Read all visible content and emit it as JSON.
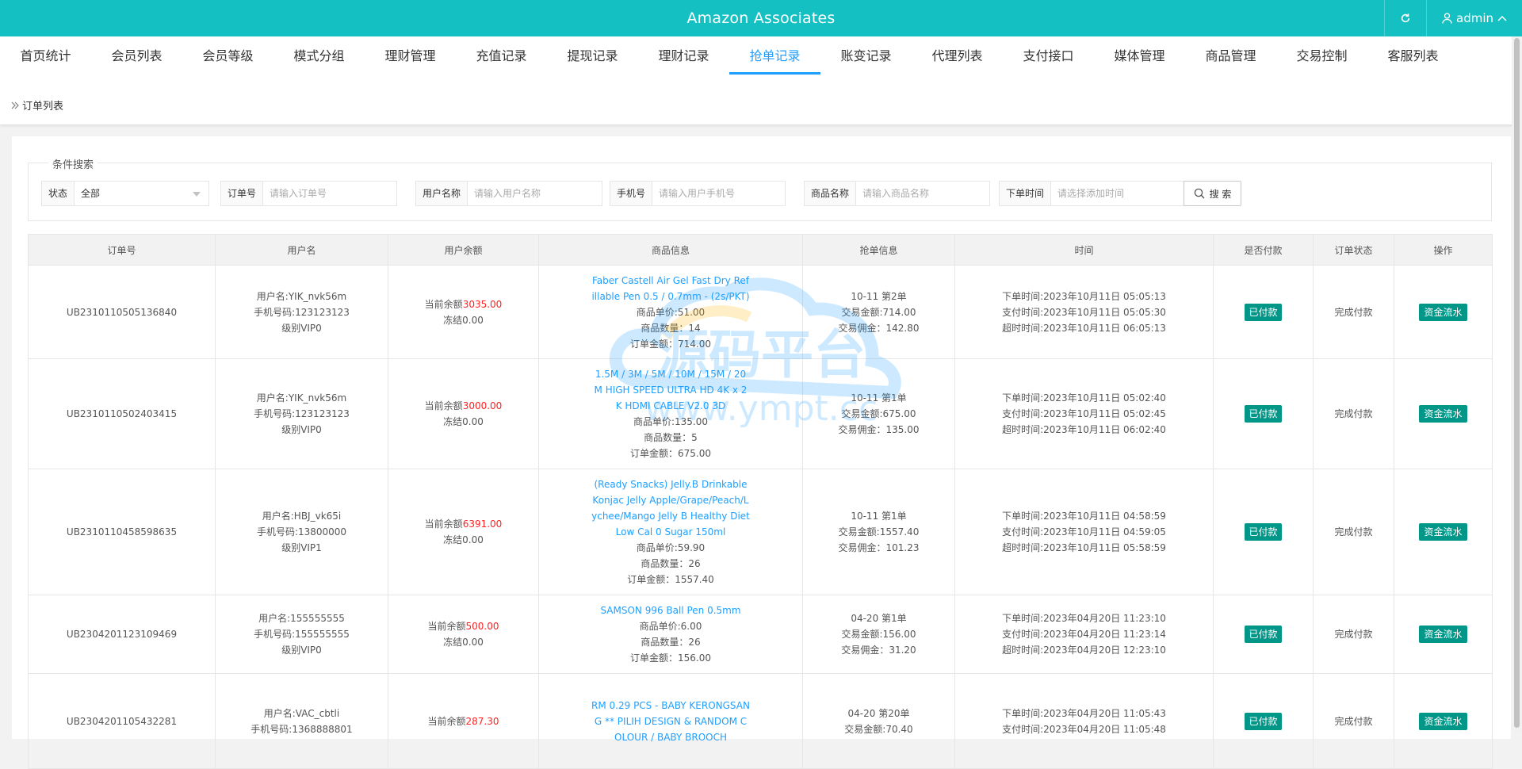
{
  "app": {
    "title": "Amazon Associates",
    "user": "admin"
  },
  "nav": {
    "tabs": [
      "首页统计",
      "会员列表",
      "会员等级",
      "模式分组",
      "理财管理",
      "充值记录",
      "提现记录",
      "理财记录",
      "抢单记录",
      "账变记录",
      "代理列表",
      "支付接口",
      "媒体管理",
      "商品管理",
      "交易控制",
      "客服列表"
    ],
    "active": "抢单记录"
  },
  "breadcrumb": "订单列表",
  "search": {
    "legend": "条件搜索",
    "status_label": "状态",
    "status_value": "全部",
    "order_label": "订单号",
    "order_placeholder": "请输入订单号",
    "username_label": "用户名称",
    "username_placeholder": "请输入用户名称",
    "phone_label": "手机号",
    "phone_placeholder": "请输入用户手机号",
    "goods_label": "商品名称",
    "goods_placeholder": "请输入商品名称",
    "time_label": "下单时间",
    "time_placeholder": "请选择添加时间",
    "button": "搜 索"
  },
  "table": {
    "headers": [
      "订单号",
      "用户名",
      "用户余额",
      "商品信息",
      "抢单信息",
      "时间",
      "是否付款",
      "订单状态",
      "操作"
    ],
    "rows": [
      {
        "order_no": "UB2310110505136840",
        "user": [
          "用户名:YIK_nvk56m",
          "手机号码:123123123",
          "级别VIP0"
        ],
        "balance_prefix": "当前余额",
        "balance": "3035.00",
        "frozen": "冻结0.00",
        "goods_name": "Faber Castell Air Gel Fast Dry Refillable Pen 0.5 / 0.7mm - (2s/PKT)",
        "goods_lines": [
          "商品单价:51.00",
          "商品数量：14",
          "订单金额：714.00"
        ],
        "grab": [
          "10-11 第2单",
          "交易金额:714.00",
          "交易佣金：142.80"
        ],
        "times": [
          "下单时间:2023年10月11日 05:05:13",
          "支付时间:2023年10月11日 05:05:30",
          "超时时间:2023年10月11日 06:05:13"
        ],
        "paid": "已付款",
        "status": "完成付款",
        "action": "资金流水"
      },
      {
        "order_no": "UB2310110502403415",
        "user": [
          "用户名:YIK_nvk56m",
          "手机号码:123123123",
          "级别VIP0"
        ],
        "balance_prefix": "当前余额",
        "balance": "3000.00",
        "frozen": "冻结0.00",
        "goods_name": "1.5M / 3M / 5M / 10M / 15M / 20M HIGH SPEED ULTRA HD 4K x 2K HDMI CABLE V2.0 3D",
        "goods_lines": [
          "商品单价:135.00",
          "商品数量：5",
          "订单金额：675.00"
        ],
        "grab": [
          "10-11 第1单",
          "交易金额:675.00",
          "交易佣金：135.00"
        ],
        "times": [
          "下单时间:2023年10月11日 05:02:40",
          "支付时间:2023年10月11日 05:02:45",
          "超时时间:2023年10月11日 06:02:40"
        ],
        "paid": "已付款",
        "status": "完成付款",
        "action": "资金流水"
      },
      {
        "order_no": "UB2310110458598635",
        "user": [
          "用户名:HBJ_vk65i",
          "手机号码:13800000",
          "级别VIP1"
        ],
        "balance_prefix": "当前余额",
        "balance": "6391.00",
        "frozen": "冻结0.00",
        "goods_name": "(Ready Snacks) Jelly.B Drinkable Konjac Jelly Apple/Grape/Peach/Lychee/Mango Jelly B Healthy Diet Low Cal 0 Sugar 150ml",
        "goods_lines": [
          "商品单价:59.90",
          "商品数量：26",
          "订单金额：1557.40"
        ],
        "grab": [
          "10-11 第1单",
          "交易金额:1557.40",
          "交易佣金：101.23"
        ],
        "times": [
          "下单时间:2023年10月11日 04:58:59",
          "支付时间:2023年10月11日 04:59:05",
          "超时时间:2023年10月11日 05:58:59"
        ],
        "paid": "已付款",
        "status": "完成付款",
        "action": "资金流水"
      },
      {
        "order_no": "UB2304201123109469",
        "user": [
          "用户名:155555555",
          "手机号码:155555555",
          "级别VIP0"
        ],
        "balance_prefix": "当前余额",
        "balance": "500.00",
        "frozen": "冻结0.00",
        "goods_name": "SAMSON 996 Ball Pen 0.5mm",
        "goods_lines": [
          "商品单价:6.00",
          "商品数量：26",
          "订单金额：156.00"
        ],
        "grab": [
          "04-20 第1单",
          "交易金额:156.00",
          "交易佣金：31.20"
        ],
        "times": [
          "下单时间:2023年04月20日 11:23:10",
          "支付时间:2023年04月20日 11:23:14",
          "超时时间:2023年04月20日 12:23:10"
        ],
        "paid": "已付款",
        "status": "完成付款",
        "action": "资金流水"
      },
      {
        "order_no": "UB2304201105432281",
        "user": [
          "用户名:VAC_cbtli",
          "手机号码:1368888801"
        ],
        "balance_prefix": "当前余额",
        "balance": "287.30",
        "frozen": "",
        "goods_name": "RM 0.29 PCS - BABY KERONGSANG ** PILIH DESIGN & RANDOM COLOUR / BABY BROOCH",
        "goods_lines": [],
        "grab": [
          "04-20 第20单",
          "交易金额:70.40"
        ],
        "times": [
          "下单时间:2023年04月20日 11:05:43",
          "支付时间:2023年04月20日 11:05:48"
        ],
        "paid": "已付款",
        "status": "完成付款",
        "action": "资金流水"
      }
    ]
  },
  "watermark": {
    "text1": "源码平台",
    "text2": "www.ympt.cc"
  }
}
